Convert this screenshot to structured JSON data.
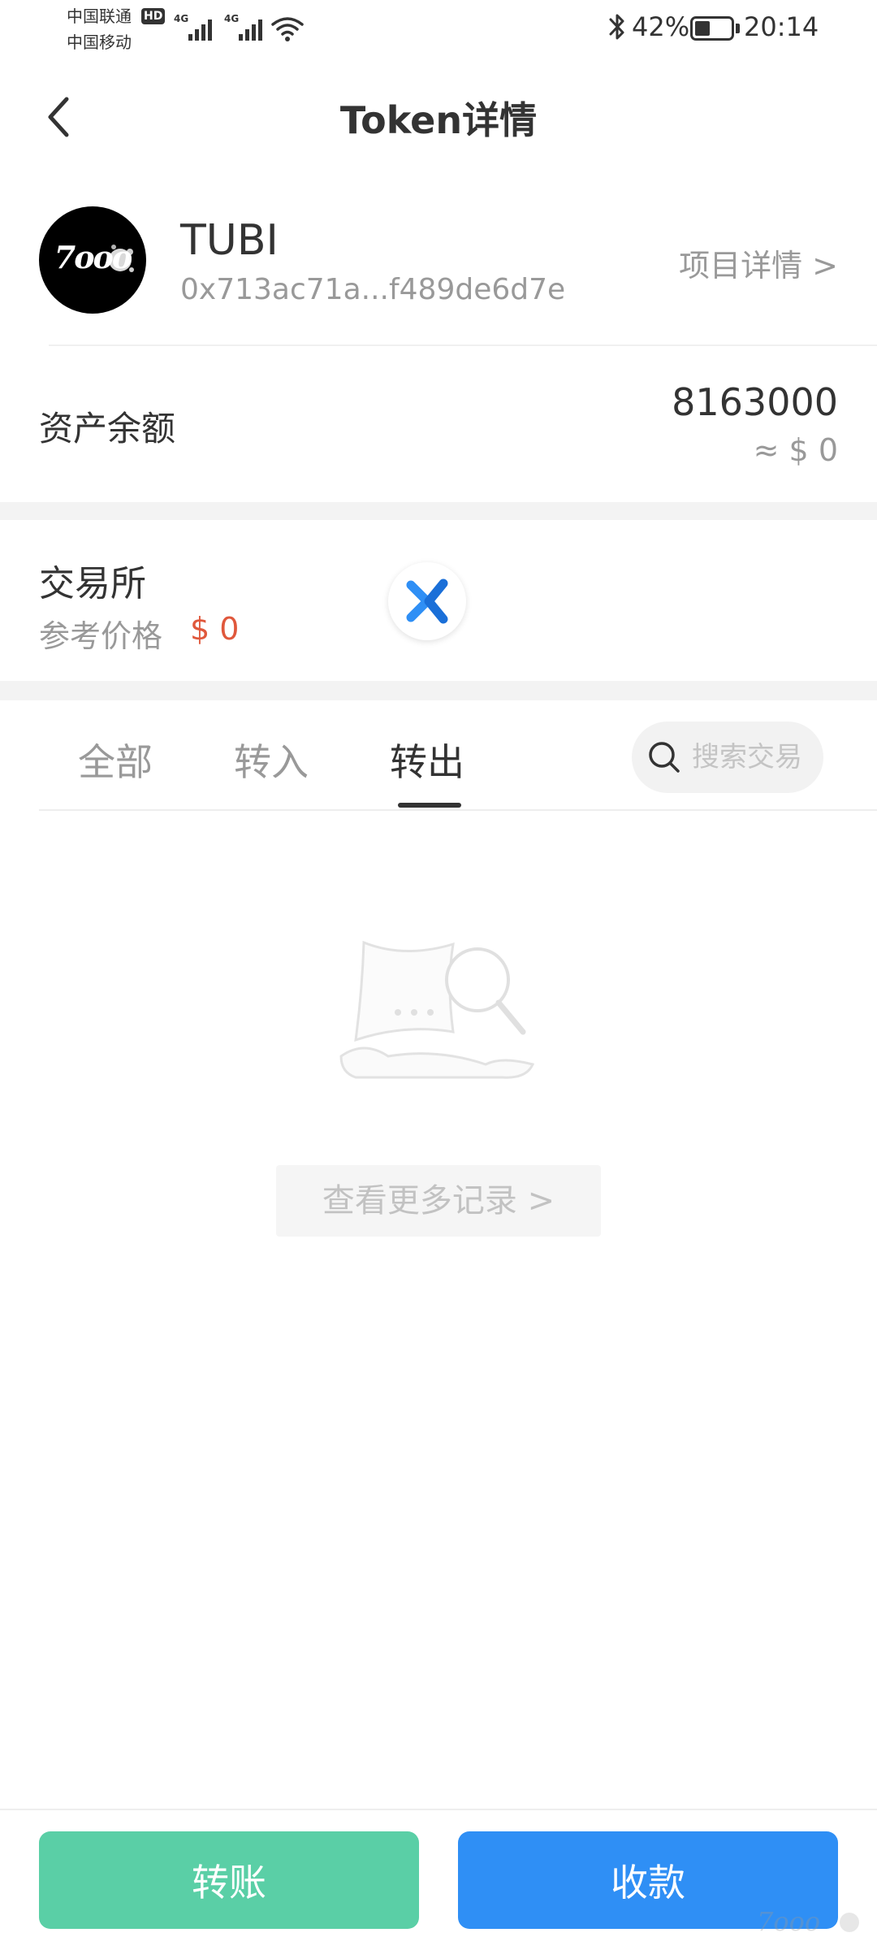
{
  "status_bar": {
    "carrier1": "中国联通",
    "carrier2": "中国移动",
    "hd_badge": "HD",
    "network1": "4G",
    "network2": "4G",
    "battery_percent": "42%",
    "battery_level": 0.42,
    "time": "20:14"
  },
  "header": {
    "title": "Token详情",
    "back_icon": "chevron-left-icon"
  },
  "token": {
    "logo_text": "7ooo",
    "name": "TUBI",
    "address": "0x713ac71a...f489de6d7e",
    "project_link": "项目详情 >"
  },
  "balance": {
    "label": "资产余额",
    "value": "8163000",
    "usd": "≈ $  0"
  },
  "exchange": {
    "title": "交易所",
    "ref_label": "参考价格",
    "price": "$ 0",
    "logo_icon": "exchange-x-icon",
    "price_color": "#e0583c"
  },
  "tabs": {
    "items": [
      "全部",
      "转入",
      "转出"
    ],
    "active_index": 2
  },
  "search": {
    "placeholder": "搜索交易"
  },
  "empty": {
    "illustration_icon": "empty-search-illustration",
    "more_label": "查看更多记录 >"
  },
  "actions": {
    "transfer_label": "转账",
    "receive_label": "收款",
    "transfer_color": "#5acfa6",
    "receive_color": "#2f8ff5"
  }
}
